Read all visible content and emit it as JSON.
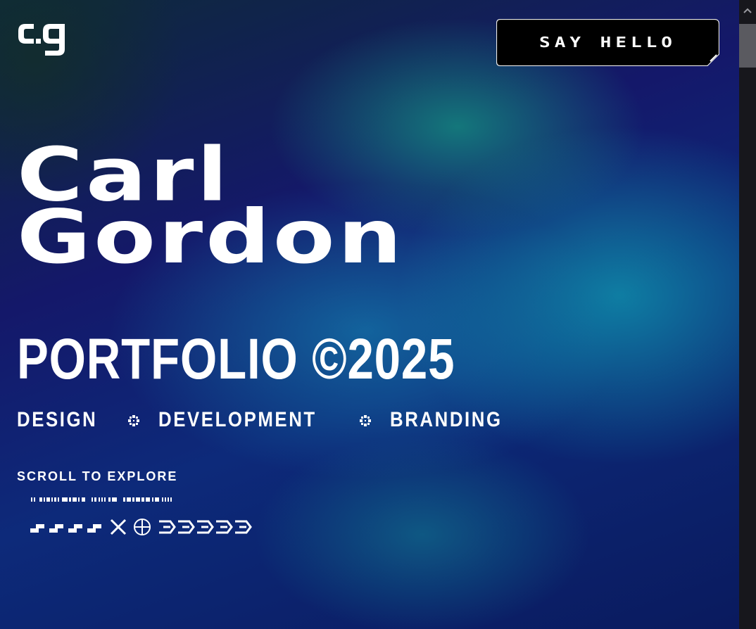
{
  "header": {
    "logo_text": "c.g",
    "cta_label": "SAY HELLO"
  },
  "hero": {
    "name_line1": "Carl",
    "name_line2": "Gordon",
    "portfolio_label": "PORTFOLIO ©2025",
    "services": [
      "DESIGN",
      "DEVELOPMENT",
      "BRANDING"
    ],
    "scroll_hint": "SCROLL TO EXPLORE"
  },
  "colors": {
    "text": "#ffffff",
    "button_bg": "#000000",
    "scrollbar_track": "#17171c",
    "scrollbar_thumb": "#5a5a60"
  },
  "icons": {
    "services_separator": "pixel-sparkle-icon",
    "decoration": [
      "barcode-icon",
      "pixel-slash-icon",
      "cross-x-icon",
      "crosshair-circle-icon",
      "chevron-arrow-icon"
    ]
  }
}
